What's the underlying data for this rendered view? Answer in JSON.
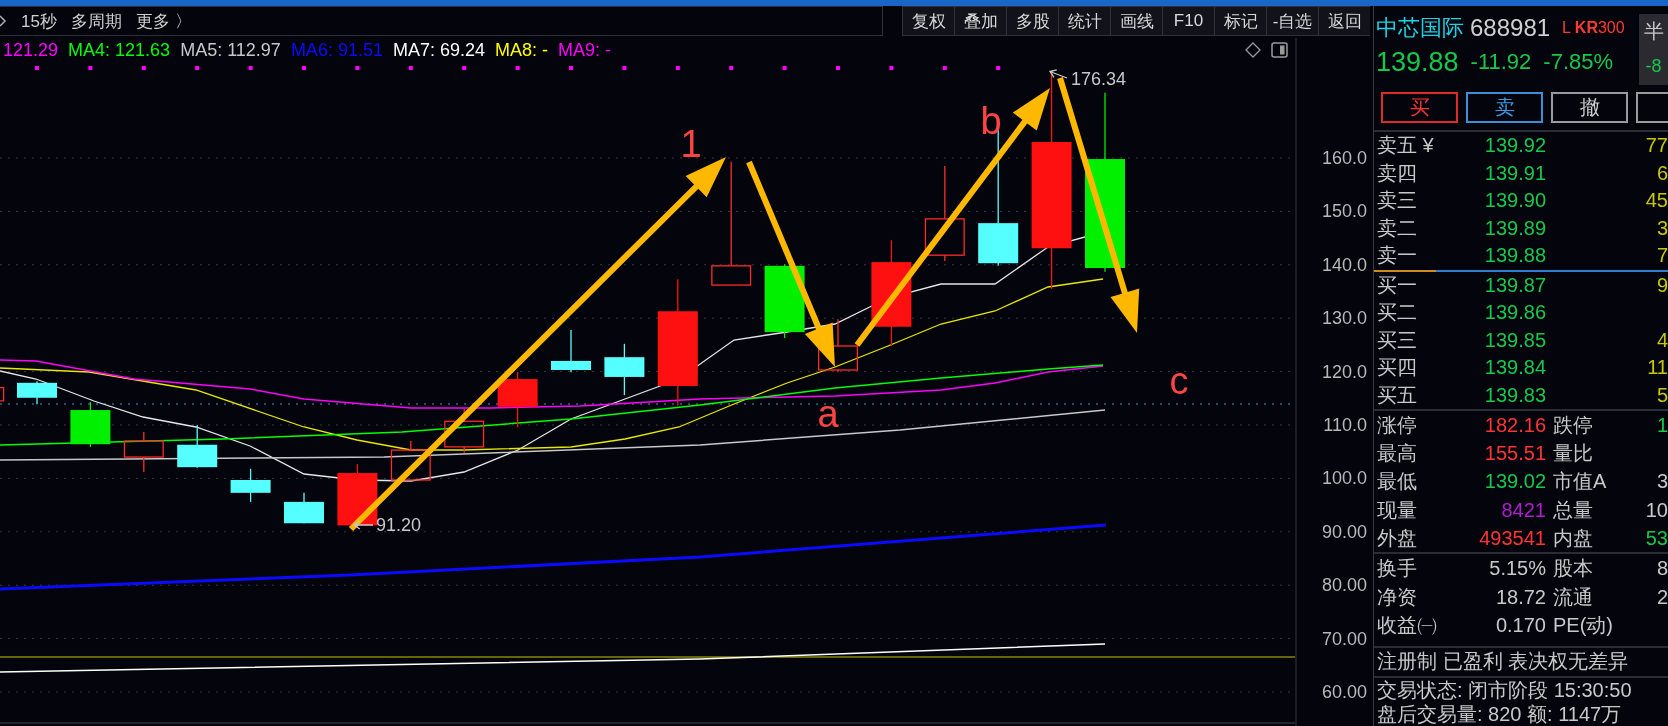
{
  "toolbar": {
    "period_items": [
      "15秒",
      "多周期",
      "更多 〉"
    ],
    "buttons": [
      "复权",
      "叠加",
      "多股",
      "统计",
      "画线",
      "F10",
      "标记",
      "-自选",
      "返回"
    ]
  },
  "chart": {
    "ma_legend": [
      {
        "text": "121.29",
        "color": "#ff00ff"
      },
      {
        "text": "MA4: 121.63",
        "color": "#00ff00"
      },
      {
        "text": "MA5: 112.97",
        "color": "#c8c8c8"
      },
      {
        "text": "MA6: 91.51",
        "color": "#0a0aff"
      },
      {
        "text": "MA7: 69.24",
        "color": "#ffffff"
      },
      {
        "text": "MA8: -",
        "color": "#ffff00"
      },
      {
        "text": "MA9: -",
        "color": "#ff00ff"
      }
    ],
    "price_labels": [
      "176.34",
      "91.20"
    ],
    "annotations": [
      "1",
      "a",
      "b",
      "c"
    ],
    "y_axis_labels": [
      "160.0",
      "150.0",
      "140.0",
      "130.0",
      "120.0",
      "110.0",
      "100.0",
      "90.00",
      "80.00",
      "70.00",
      "60.00"
    ]
  },
  "quote": {
    "name": "中芯国际",
    "code": "688981",
    "badge": "L **KR**300",
    "price": "139.88",
    "change": "-11.92",
    "change_percent": "-7.85%",
    "side_box": {
      "label": "半",
      "value": "-8"
    }
  },
  "trade_buttons": [
    {
      "kind": "buy",
      "label": "买"
    },
    {
      "kind": "sell",
      "label": "卖"
    },
    {
      "kind": "cancel",
      "label": "撤"
    },
    {
      "kind": "partial"
    }
  ],
  "order_book": {
    "asks": [
      {
        "label": "卖五 ¥",
        "price": "139.92",
        "volume": "77"
      },
      {
        "label": "卖四",
        "price": "139.91",
        "volume": "6"
      },
      {
        "label": "卖三",
        "price": "139.90",
        "volume": "45"
      },
      {
        "label": "卖二",
        "price": "139.89",
        "volume": "3"
      },
      {
        "label": "卖一",
        "price": "139.88",
        "volume": "7"
      }
    ],
    "ratio_bar": {
      "level": 0.21
    },
    "bids": [
      {
        "label": "买一",
        "price": "139.87",
        "volume": "9"
      },
      {
        "label": "买二",
        "price": "139.86"
      },
      {
        "label": "买三",
        "price": "139.85",
        "volume": "4"
      },
      {
        "label": "买四",
        "price": "139.84",
        "volume": "11"
      },
      {
        "label": "买五",
        "price": "139.83",
        "volume": "5"
      }
    ]
  },
  "stats": [
    {
      "label": "涨停",
      "value": "182.16",
      "color": "#ff3434"
    },
    {
      "label": "跌停",
      "value": "1",
      "color": "#16c84c"
    },
    {
      "label": "最高",
      "value": "155.51",
      "color": "#ff3434"
    },
    {
      "label": "量比"
    },
    {
      "label": "最低",
      "value": "139.02",
      "color": "#16c84c"
    },
    {
      "label": "市值A",
      "value": "3",
      "color": "#c8c8c8"
    },
    {
      "label": "现量",
      "value": "8421",
      "color": "#b01ed0"
    },
    {
      "label": "总量",
      "value": "10",
      "color": "#c8c8c8"
    },
    {
      "label": "外盘",
      "value": "493541",
      "color": "#ff3434"
    },
    {
      "label": "内盘",
      "value": "53",
      "color": "#16c84c"
    }
  ],
  "fundamentals": [
    {
      "label": "换手",
      "value": "5.15%"
    },
    {
      "label": "股本",
      "value": "8"
    },
    {
      "label": "净资",
      "value": "18.72"
    },
    {
      "label": "流通",
      "value": "2"
    },
    {
      "label": "收益㈠",
      "value": "0.170"
    },
    {
      "label": "PE(动)"
    }
  ],
  "tags": "注册制 已盈利 表决权无差异",
  "trading_status": "交易状态: 闭市阶段 15:30:50",
  "after_hours": "盘后交易量: 820 额: 1147万"
}
